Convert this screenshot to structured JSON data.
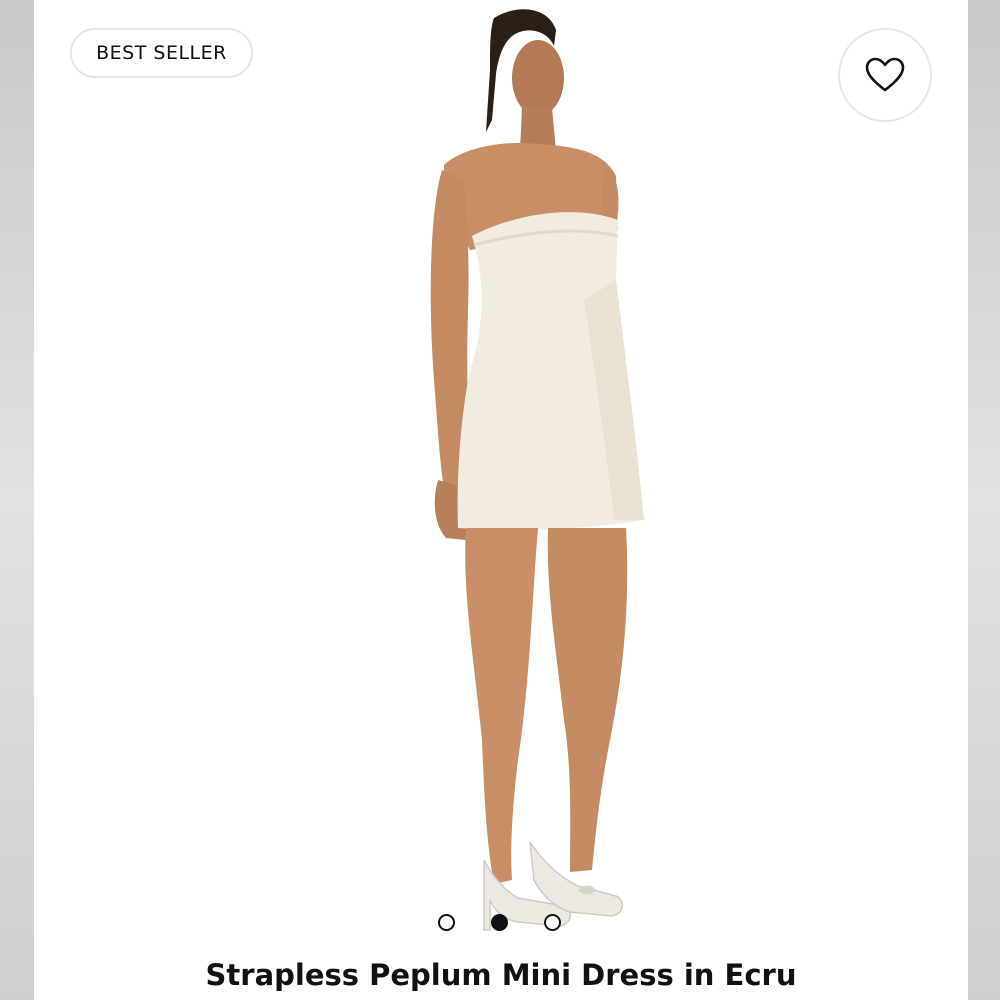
{
  "badge": {
    "label": "BEST SELLER"
  },
  "favorite": {
    "icon": "heart-icon"
  },
  "gallery": {
    "total": 3,
    "active_index": 1
  },
  "product": {
    "title": "Strapless Peplum Mini Dress in Ecru"
  },
  "colors": {
    "dress": "#f2ece0",
    "skin": "#c98e66",
    "text": "#111111"
  }
}
